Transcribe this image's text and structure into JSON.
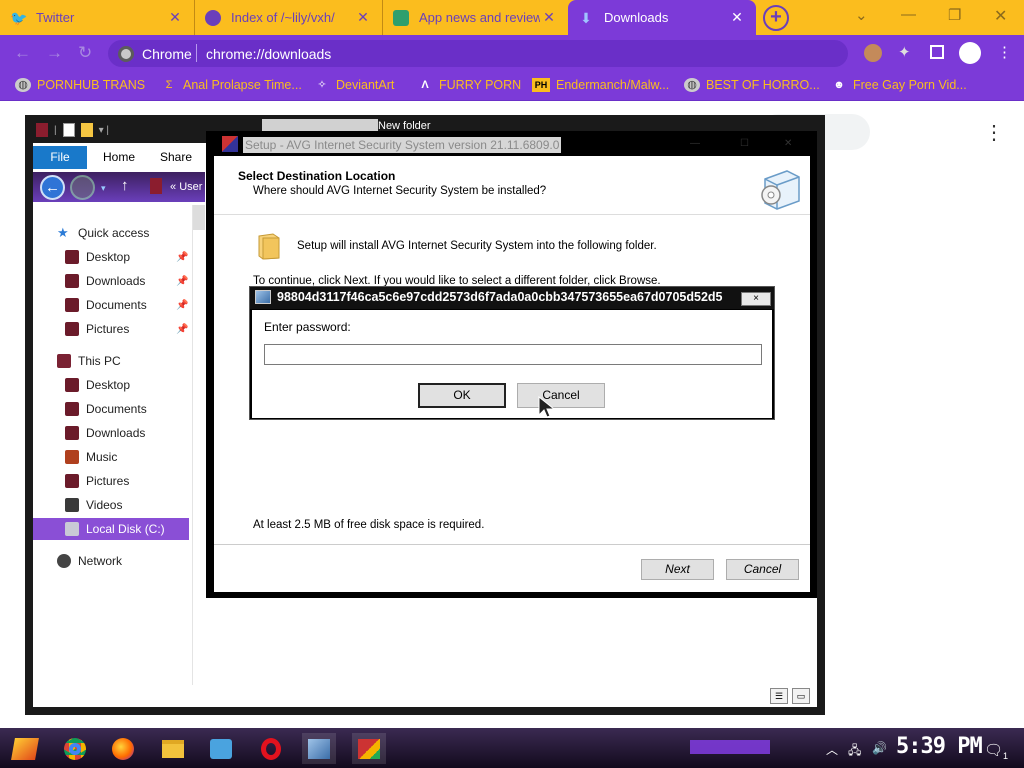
{
  "browser": {
    "tabs": [
      {
        "title": "Twitter",
        "icon": "twitter-bird-icon",
        "active": false
      },
      {
        "title": "Index of /~lily/vxh/",
        "icon": "spy-icon",
        "active": false
      },
      {
        "title": "App news and reviews",
        "icon": "globe-icon",
        "active": false
      },
      {
        "title": "Downloads",
        "icon": "download-icon",
        "active": true
      }
    ],
    "new_tab_label": "+",
    "window_controls": {
      "minimize": "—",
      "restore": "❐",
      "close": "✕",
      "chevron": "⌄"
    },
    "omnibox": {
      "scheme_label": "Chrome",
      "url_prefix": "chrome://",
      "url_path": "downloads"
    },
    "bookmarks": [
      {
        "label": "PORNHUB TRANS",
        "icon": "globe-icon"
      },
      {
        "label": "Anal Prolapse Time...",
        "icon": "bookmark-icon"
      },
      {
        "label": "DeviantArt",
        "icon": "deviantart-icon"
      },
      {
        "label": "FURRY PORN",
        "icon": "caret-icon"
      },
      {
        "label": "Endermanch/Malw...",
        "icon": "ph-icon"
      },
      {
        "label": "BEST OF HORRO...",
        "icon": "globe-icon"
      },
      {
        "label": "Free Gay Porn Vid...",
        "icon": "spy-icon"
      }
    ],
    "accent": "#7c3ad8",
    "tabstrip_color": "#fbbd1e"
  },
  "explorer": {
    "ribbon_tabs": [
      "File",
      "Home",
      "Share"
    ],
    "breadcrumb": "User",
    "background_tab_label": "New folder",
    "nav": {
      "quick_access": {
        "label": "Quick access",
        "items": [
          "Desktop",
          "Downloads",
          "Documents",
          "Pictures"
        ]
      },
      "this_pc": {
        "label": "This PC",
        "items": [
          "Desktop",
          "Documents",
          "Downloads",
          "Music",
          "Pictures",
          "Videos",
          "Local Disk (C:)"
        ]
      },
      "network": {
        "label": "Network"
      }
    },
    "selected_item": "Local Disk (C:)"
  },
  "setup": {
    "title": "Setup - AVG Internet Security System version 21.11.6809.0",
    "heading": "Select Destination Location",
    "subheading": "Where should AVG Internet Security System be installed?",
    "install_line": "Setup will install AVG Internet Security System into the following folder.",
    "continue_line": "To continue, click Next. If you would like to select a different folder, click Browse.",
    "space_line": "At least 2.5 MB of free disk space is required.",
    "next_label": "Next",
    "cancel_label": "Cancel"
  },
  "password_dialog": {
    "title": "98804d3117f46ca5c6e97cdd2573d6f7ada0a0cbb347573655ea67d0705d52d5",
    "prompt": "Enter password:",
    "value": "",
    "ok_label": "OK",
    "cancel_label": "Cancel",
    "close_label": "×"
  },
  "taskbar": {
    "apps": [
      "start-logo-icon",
      "chrome-icon",
      "firefox-icon",
      "file-explorer-icon",
      "photos-icon",
      "opera-icon",
      "setup-app-icon",
      "avg-app-icon"
    ],
    "clock": "5:39 PM",
    "notifications": "1"
  }
}
